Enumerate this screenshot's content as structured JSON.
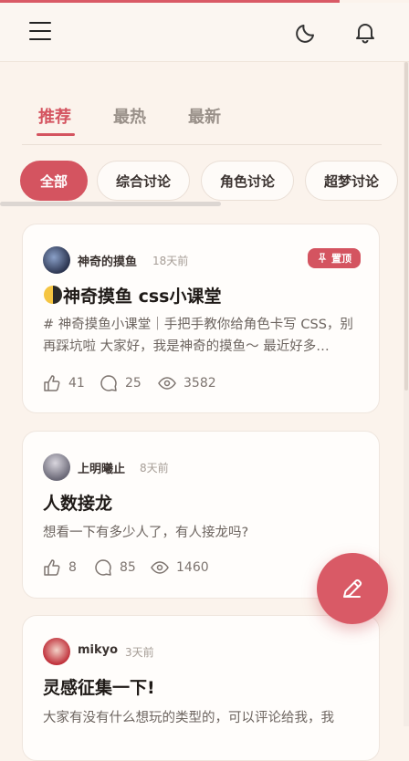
{
  "header": {
    "icons": [
      "menu-icon",
      "moon-icon",
      "bell-icon"
    ]
  },
  "tabs": [
    {
      "label": "推荐",
      "active": true
    },
    {
      "label": "最热",
      "active": false
    },
    {
      "label": "最新",
      "active": false
    }
  ],
  "chips": [
    {
      "label": "全部",
      "active": true
    },
    {
      "label": "综合讨论",
      "active": false
    },
    {
      "label": "角色讨论",
      "active": false
    },
    {
      "label": "超梦讨论",
      "active": false
    }
  ],
  "posts": [
    {
      "author": "神奇的摸鱼",
      "time": "18天前",
      "badge": "置顶",
      "title_emoji": "moon-emoji",
      "title": "神奇摸鱼 css小课堂",
      "excerpt": "# 神奇摸鱼小课堂｜手把手教你给角色卡写 CSS，别再踩坑啦 大家好，我是神奇的摸鱼～ 最近好多…",
      "likes": "41",
      "comments": "25",
      "views": "3582"
    },
    {
      "author": "上明曦止",
      "time": "8天前",
      "title": "人数接龙",
      "excerpt": "想看一下有多少人了，有人接龙吗?",
      "likes": "8",
      "comments": "85",
      "views": "1460"
    },
    {
      "author": "mikyo",
      "time": "3天前",
      "title": "灵感征集一下!",
      "excerpt": "大家有没有什么想玩的类型的，可以评论给我，我"
    }
  ],
  "fab": {
    "icon": "pencil-icon"
  },
  "colors": {
    "accent": "#d45460",
    "background": "#fbf3ec"
  }
}
